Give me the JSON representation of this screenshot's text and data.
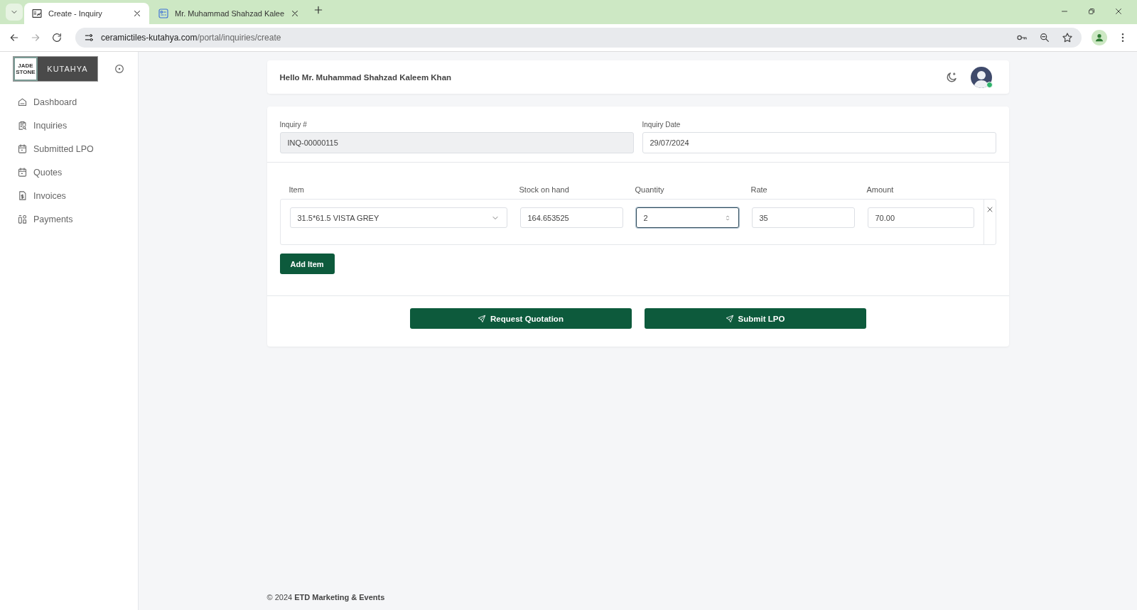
{
  "browser": {
    "tabs": [
      {
        "title": "Create - Inquiry",
        "selected": true
      },
      {
        "title": "Mr. Muhammad Shahzad Kalee",
        "selected": false
      }
    ],
    "url_host": "ceramictiles-kutahya.com",
    "url_path": "/portal/inquiries/create"
  },
  "sidebar": {
    "logo": {
      "left": "JADE STONE",
      "right": "KUTAHYA"
    },
    "items": [
      {
        "label": "Dashboard"
      },
      {
        "label": "Inquiries"
      },
      {
        "label": "Submitted LPO"
      },
      {
        "label": "Quotes"
      },
      {
        "label": "Invoices"
      },
      {
        "label": "Payments"
      }
    ]
  },
  "header": {
    "greeting": "Hello Mr. Muhammad Shahzad Kaleem Khan",
    "online": true
  },
  "inquiry": [
    {
      "label": "Inquiry #",
      "value": "INQ-00000115",
      "disabled": true
    },
    {
      "label": "Inquiry Date",
      "value": "29/07/2024",
      "disabled": false
    }
  ],
  "items_table": {
    "columns": [
      "Item",
      "Stock on hand",
      "Quantity",
      "Rate",
      "Amount"
    ],
    "rows": [
      {
        "cells": [
          {
            "kind": "select",
            "value": "31.5*61.5 VISTA GREY",
            "focused": false
          },
          {
            "kind": "text",
            "value": "164.653525",
            "focused": false
          },
          {
            "kind": "number",
            "value": "2",
            "focused": true
          },
          {
            "kind": "text",
            "value": "35",
            "focused": false
          },
          {
            "kind": "text",
            "value": "70.00",
            "focused": false
          }
        ]
      }
    ]
  },
  "add_button": "Add Item",
  "actions": [
    "Request Quotation",
    "Submit LPO"
  ],
  "footer": "© 2024 **ETD Marketing & Events**"
}
